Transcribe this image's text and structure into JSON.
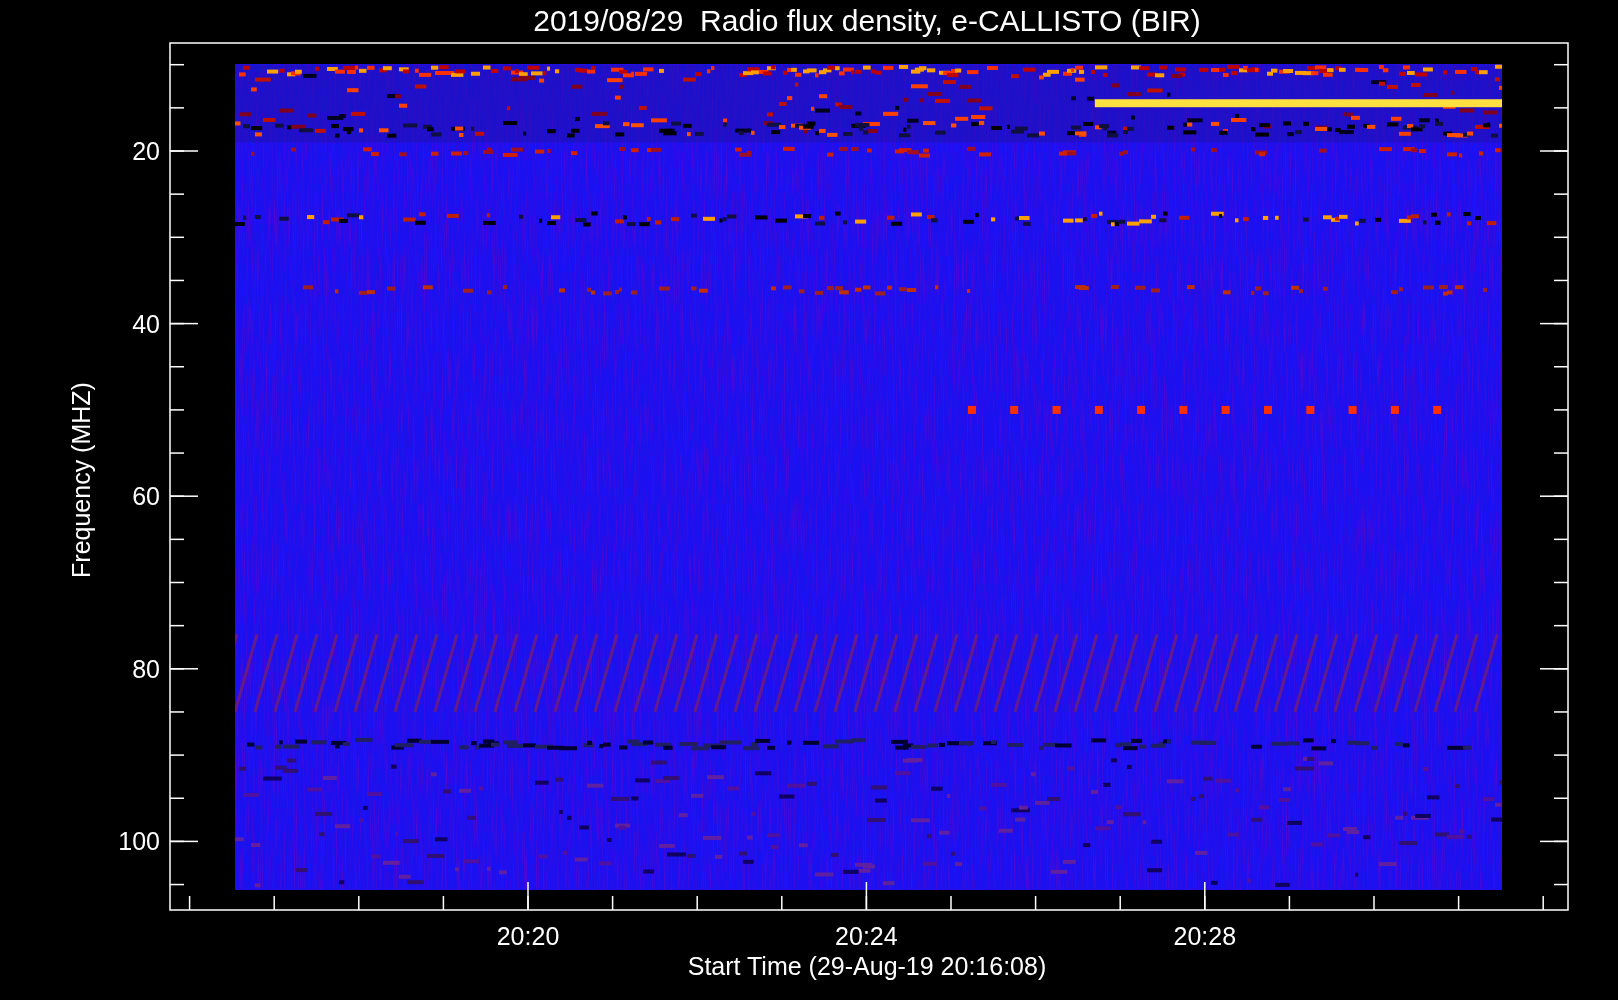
{
  "title": "2019/08/29  Radio flux density, e-CALLISTO (BIR)",
  "y_axis": {
    "label": "Frequency (MHZ)",
    "ticks": [
      "20",
      "40",
      "60",
      "80",
      "100"
    ]
  },
  "x_axis": {
    "label": "Start Time (29-Aug-19 20:16:08)",
    "ticks": [
      "20:20",
      "20:24",
      "20:28"
    ]
  }
}
